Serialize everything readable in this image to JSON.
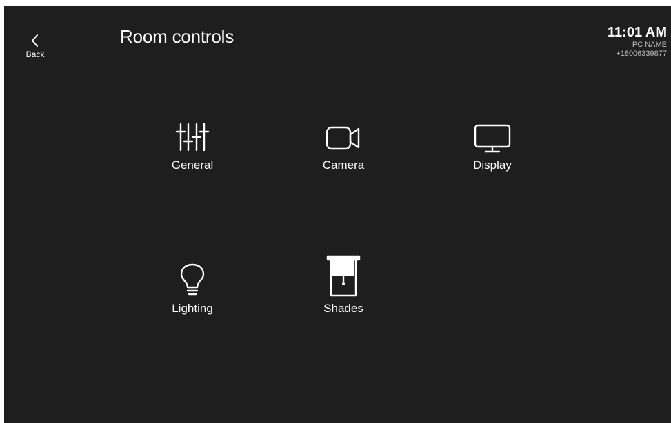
{
  "header": {
    "back_label": "Back",
    "title": "Room controls"
  },
  "status": {
    "time": "11:01 AM",
    "pc_name": "PC NAME",
    "phone": "+18006339877"
  },
  "tiles": [
    {
      "label": "General",
      "icon": "sliders-icon"
    },
    {
      "label": "Camera",
      "icon": "camera-icon"
    },
    {
      "label": "Display",
      "icon": "monitor-icon"
    },
    {
      "label": "Lighting",
      "icon": "lightbulb-icon"
    },
    {
      "label": "Shades",
      "icon": "shades-icon"
    }
  ],
  "colors": {
    "background": "#1e1e1e",
    "foreground": "#ffffff",
    "secondary_text": "#bdbdbd"
  }
}
